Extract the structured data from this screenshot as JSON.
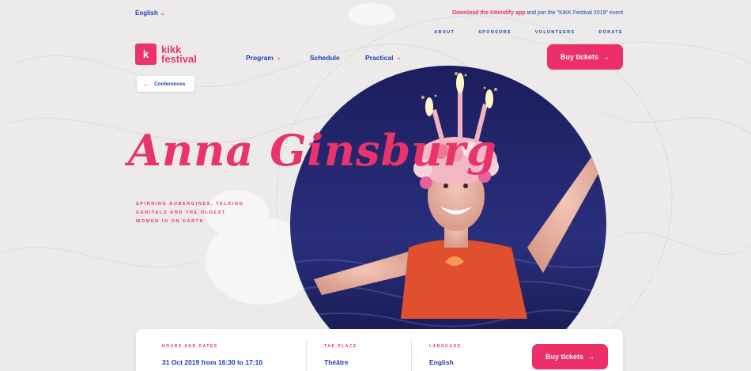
{
  "language": {
    "current": "English"
  },
  "promo": {
    "highlight": "Download the Attendify app",
    "rest": "and join the \"KIKK Festival 2019\" event."
  },
  "top_links": [
    "ABOUT",
    "SPONSORS",
    "VOLUNTEERS",
    "DONATE"
  ],
  "logo": {
    "mark": "k",
    "line1": "kikk",
    "line2": "festival"
  },
  "nav": {
    "program": "Program",
    "schedule": "Schedule",
    "practical": "Practical"
  },
  "buy_label": "Buy tickets",
  "back": {
    "label": "Conferences"
  },
  "speaker": {
    "name": "Anna Ginsburg",
    "tagline": "Spinning aubergines, talking genitals and the oldest women in on earth"
  },
  "info": {
    "dates_label": "HOURS AND DATES",
    "dates_value": "31 Oct 2019 from 16:30 to 17:10",
    "place_label": "THE PLACE",
    "place_value": "Théâtre",
    "lang_label": "LANGUAGE",
    "lang_value": "English"
  },
  "colors": {
    "accent": "#e8336b",
    "link": "#1d3fb8",
    "background": "#ecebea"
  },
  "icons": [
    "chevron-down-icon",
    "arrow-right-icon",
    "arrow-left-icon",
    "kikk-logo-icon"
  ]
}
